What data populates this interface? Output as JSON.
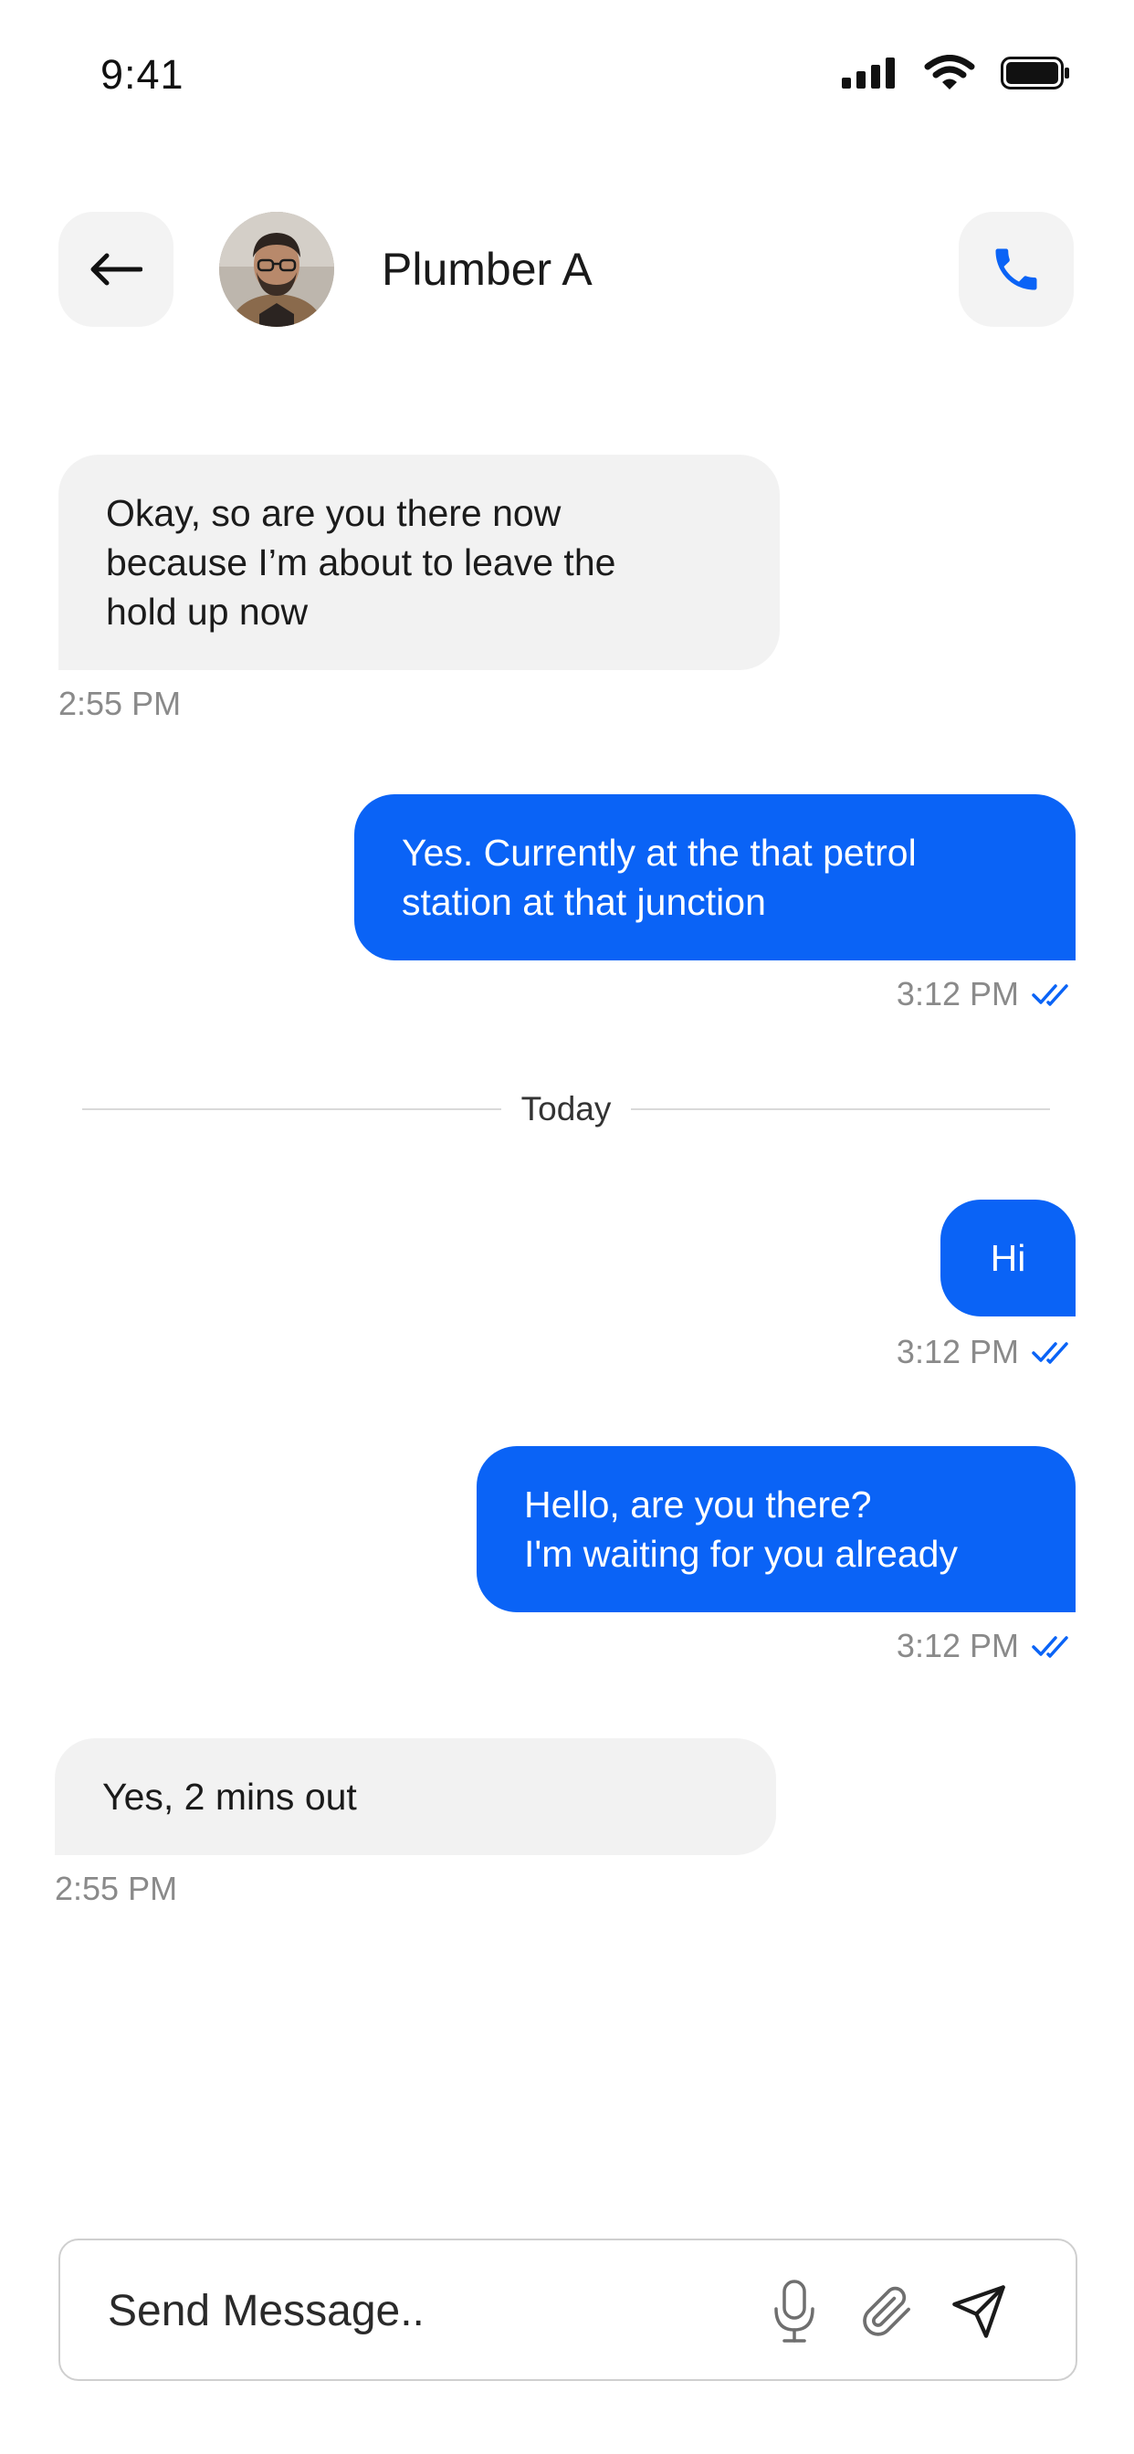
{
  "status": {
    "time": "9:41"
  },
  "header": {
    "contact_name": "Plumber A"
  },
  "messages": [
    {
      "direction": "incoming",
      "text": "Okay, so are you there now\nbecause I’m about to leave the\nhold up now",
      "time": "2:55 PM"
    },
    {
      "direction": "outgoing",
      "text": "Yes. Currently at the that petrol\nstation at that junction",
      "time": "3:12 PM",
      "read": true
    },
    {
      "direction": "outgoing",
      "text": "Hi",
      "time": "3:12 PM",
      "read": true
    },
    {
      "direction": "outgoing",
      "text": "Hello, are you there?\nI'm waiting for you already",
      "time": "3:12 PM",
      "read": true
    },
    {
      "direction": "incoming",
      "text": "Yes, 2 mins out",
      "time": "2:55 PM"
    }
  ],
  "divider": {
    "label": "Today"
  },
  "composer": {
    "placeholder": "Send Message.."
  },
  "icons": {
    "back": "arrow-left-icon",
    "call": "phone-icon",
    "mic": "microphone-icon",
    "attach": "paperclip-icon",
    "send": "send-icon",
    "read_receipt": "double-check-icon"
  },
  "colors": {
    "accent": "#0a63f6",
    "incoming_bubble": "#f2f2f2",
    "button_bg": "#f3f3f3"
  }
}
